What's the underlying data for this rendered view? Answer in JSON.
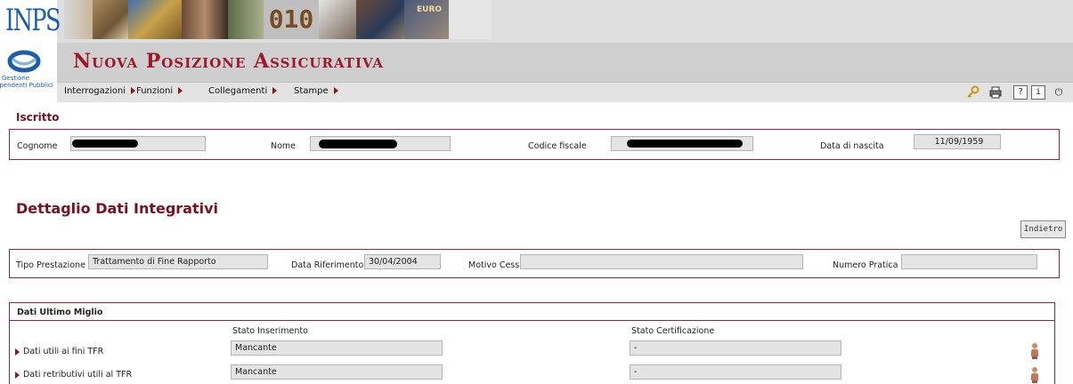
{
  "header": {
    "logo_text": "INPS",
    "logo_subtext": "Gestione",
    "logo_subtext2": "Dipendenti Pubblici",
    "title": "Nuova Posizione Assicurativa",
    "photo_numbers": "010",
    "photo_euro": "EURO"
  },
  "menu": {
    "items": [
      {
        "label": "Interrogazioni"
      },
      {
        "label": "Funzioni"
      },
      {
        "label": "Collegamenti"
      },
      {
        "label": "Stampe"
      }
    ],
    "tools": {
      "key_icon": "key-icon",
      "print_icon": "printer-icon",
      "help_label": "?",
      "info_label": "i"
    }
  },
  "iscritto": {
    "section_title": "Iscritto",
    "cognome_label": "Cognome",
    "nome_label": "Nome",
    "codice_fiscale_label": "Codice fiscale",
    "data_nascita_label": "Data di nascita",
    "data_nascita_value": "11/09/1959"
  },
  "dettaglio": {
    "title": "Dettaglio Dati Integrativi",
    "back_button": "Indietro",
    "tipo_prestazione_label": "Tipo Prestazione",
    "tipo_prestazione_value": "Trattamento di Fine Rapporto",
    "data_riferimento_label": "Data Riferimento",
    "data_riferimento_value": "30/04/2004",
    "motivo_cess_label": "Motivo Cess.",
    "motivo_cess_value": "",
    "numero_pratica_label": "Numero Pratica",
    "numero_pratica_value": ""
  },
  "ultimo_miglio": {
    "title": "Dati Ultimo Miglio",
    "col_stato_inserimento": "Stato Inserimento",
    "col_stato_certificazione": "Stato Certificazione",
    "rows": [
      {
        "label": "Dati utili ai fini TFR",
        "stato_inserimento": "Mancante",
        "stato_certificazione": "-"
      },
      {
        "label": "Dati retributivi utili al TFR",
        "stato_inserimento": "Mancante",
        "stato_certificazione": "-"
      }
    ]
  },
  "colors": {
    "brand_red": "#a0182e",
    "border_red": "#8a2a36",
    "inps_blue": "#1a5fa8"
  }
}
